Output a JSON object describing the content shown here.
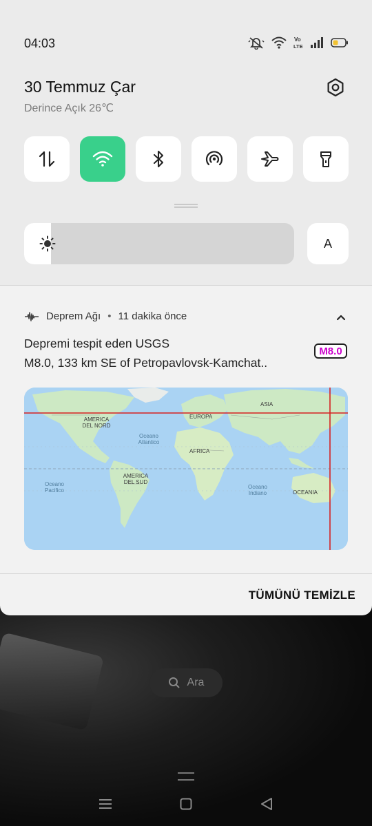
{
  "status_bar": {
    "time": "04:03",
    "icons": [
      "mute-icon",
      "wifi-icon",
      "volte-icon",
      "signal-icon",
      "battery-low-icon"
    ],
    "volte_label": "Vo LTE"
  },
  "header": {
    "date": "30 Temmuz Çar",
    "weather": "Derince Açık 26℃"
  },
  "quick_tiles": [
    {
      "name": "mobile-data",
      "icon": "mobile-data-icon",
      "active": false
    },
    {
      "name": "wifi",
      "icon": "wifi-icon",
      "active": true
    },
    {
      "name": "bluetooth",
      "icon": "bluetooth-icon",
      "active": false
    },
    {
      "name": "hotspot",
      "icon": "hotspot-icon",
      "active": false
    },
    {
      "name": "airplane-mode",
      "icon": "airplane-icon",
      "active": false
    },
    {
      "name": "flashlight",
      "icon": "flashlight-icon",
      "active": false
    }
  ],
  "brightness": {
    "level": 0.1,
    "auto_label": "A"
  },
  "notification": {
    "app_name": "Deprem Ağı",
    "separator": "•",
    "time_ago": "11 dakika önce",
    "title": "Depremi tespit eden USGS",
    "body": "M8.0, 133 km SE of Petropavlovsk-Kamchat..",
    "magnitude": "M8.0",
    "map_labels": {
      "asia": "ASIA",
      "europa": "EUROPA",
      "north_america": "AMERICA DEL NORD",
      "oceano_atlantico": "Oceano Atlantico",
      "africa": "AFRICA",
      "south_america": "AMERICA DEL SUD",
      "oceano_pacifico": "Oceano Pacifico",
      "oceano_indiano": "Oceano Indiano",
      "oceania": "OCEANIA"
    }
  },
  "clear_all_label": "TÜMÜNÜ TEMİZLE",
  "search": {
    "label": "Ara"
  },
  "colors": {
    "accent_tile": "#39d08b",
    "magnitude_text": "#cc00cc",
    "crosshair": "#d62020"
  }
}
